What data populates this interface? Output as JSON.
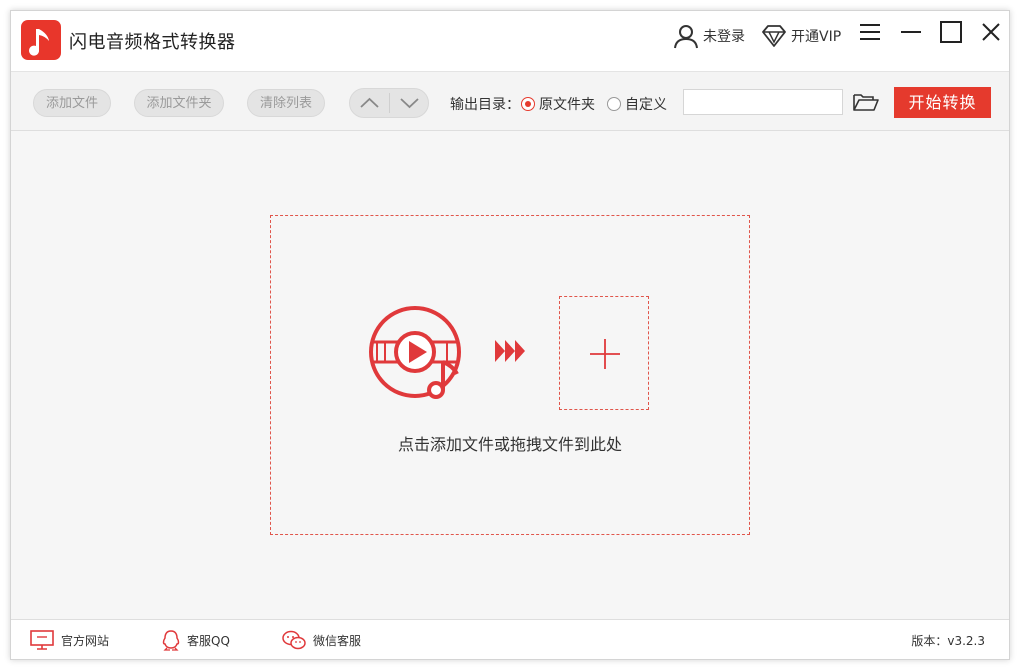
{
  "app": {
    "title": "闪电音频格式转换器"
  },
  "header": {
    "login_label": "未登录",
    "vip_label": "开通VIP"
  },
  "toolbar": {
    "add_file_label": "添加文件",
    "add_folder_label": "添加文件夹",
    "clear_list_label": "清除列表",
    "output_dir_label": "输出目录：",
    "radio_original_label": "原文件夹",
    "radio_custom_label": "自定义",
    "selected_output": "原文件夹",
    "path_value": "",
    "start_label": "开始转换"
  },
  "dropzone": {
    "hint": "点击添加文件或拖拽文件到此处"
  },
  "footer": {
    "website_label": "官方网站",
    "qq_label": "客服QQ",
    "wechat_label": "微信客服",
    "version": "版本：v3.2.3"
  },
  "colors": {
    "accent": "#e53a2d",
    "background": "#f6f6f6"
  },
  "icons": [
    "app-logo-icon",
    "user-icon",
    "diamond-icon",
    "menu-icon",
    "minimize-icon",
    "maximize-icon",
    "close-icon",
    "chevron-up-icon",
    "chevron-down-icon",
    "folder-open-icon",
    "media-play-icon",
    "fast-forward-icon",
    "plus-icon",
    "monitor-icon",
    "qq-icon",
    "wechat-icon"
  ]
}
